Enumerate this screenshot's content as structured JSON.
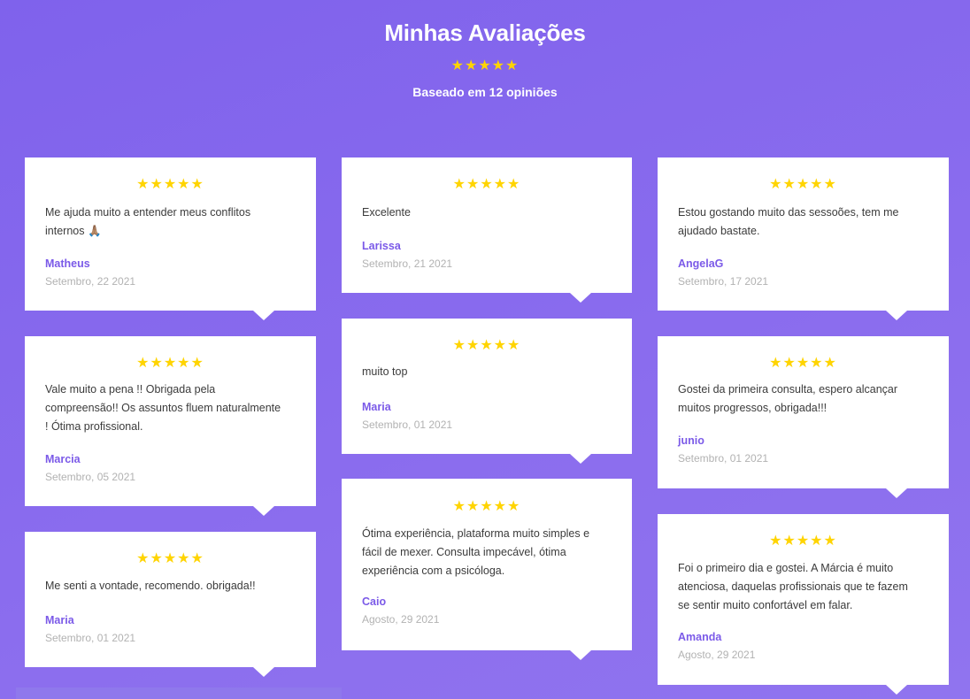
{
  "header": {
    "title": "Minhas Avaliações",
    "stars": "★★★★★",
    "subtitle": "Baseado em 12 opiniões"
  },
  "reviews": [
    {
      "stars": "★★★★★",
      "text": "Me ajuda muito a entender meus conflitos internos 🙏🏽",
      "name": "Matheus",
      "date": "Setembro, 22 2021"
    },
    {
      "stars": "★★★★★",
      "text": "Vale muito a pena !! Obrigada pela compreensão!! Os assuntos fluem naturalmente ! Ótima profissional.",
      "name": "Marcia",
      "date": "Setembro, 05 2021"
    },
    {
      "stars": "★★★★★",
      "text": "Me senti a vontade, recomendo. obrigada!!",
      "name": "Maria",
      "date": "Setembro, 01 2021"
    },
    {
      "stars": "★★★★★",
      "text": "Excelente",
      "name": "Larissa",
      "date": "Setembro, 21 2021"
    },
    {
      "stars": "★★★★★",
      "text": "muito top",
      "name": "Maria",
      "date": "Setembro, 01 2021"
    },
    {
      "stars": "★★★★★",
      "text": "Ótima experiência, plataforma muito simples e fácil de mexer. Consulta impecável, ótima experiência com a psicóloga.",
      "name": "Caio",
      "date": "Agosto, 29 2021"
    },
    {
      "stars": "★★★★★",
      "text": "Estou gostando muito das sessoões, tem me ajudado bastate.",
      "name": "AngelaG",
      "date": "Setembro, 17 2021"
    },
    {
      "stars": "★★★★★",
      "text": "Gostei da primeira consulta, espero alcançar muitos progressos, obrigada!!!",
      "name": "junio",
      "date": "Setembro, 01 2021"
    },
    {
      "stars": "★★★★★",
      "text": "Foi o primeiro dia e gostei. A Márcia é muito atenciosa, daquelas profissionais que te fazem se sentir muito confortável em falar.",
      "name": "Amanda",
      "date": "Agosto, 29 2021"
    }
  ]
}
